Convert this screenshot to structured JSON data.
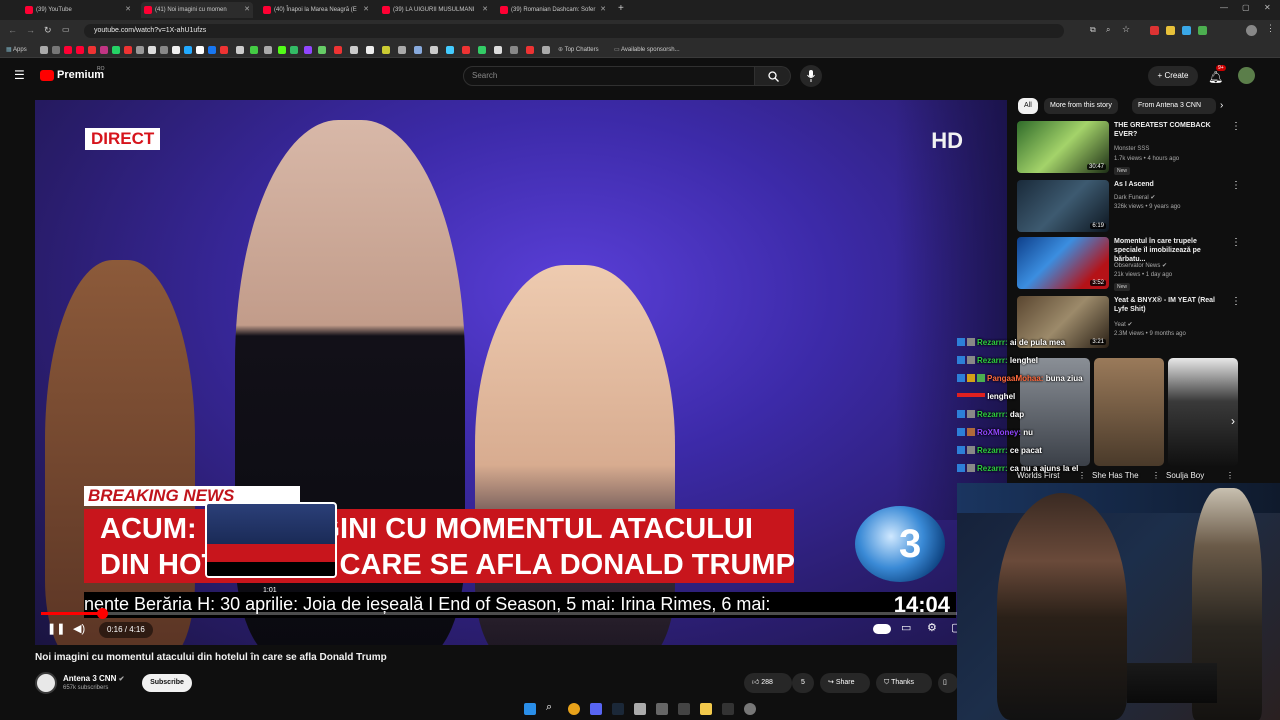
{
  "browser": {
    "tabs": [
      {
        "label": "(39) YouTube"
      },
      {
        "label": "(41) Noi imagini cu momen"
      },
      {
        "label": "(40) Înapoi la Marea Neagră (E"
      },
      {
        "label": "(39) LA UIGURII MUSULMANI"
      },
      {
        "label": "(39) Romanian Dashcam: Sofer"
      }
    ],
    "url": "youtube.com/watch?v=1X-ahU1ufzs",
    "bookmarks": {
      "apps": "Apps",
      "top_chatters": "Top Chatters",
      "sponsors": "Available sponsorsh..."
    }
  },
  "masthead": {
    "logo": "Premium",
    "logo_badge": "RO",
    "search_placeholder": "Search",
    "create_label": "Create",
    "notification_count": "9+"
  },
  "video": {
    "direct_label": "DIRECT",
    "hd_label": "HD",
    "breaking_label": "BREAKING NEWS",
    "headline_line1": "ACUM: NOI IMAGINI CU MOMENTUL ATACULUI",
    "headline_line2": "DIN HOTELUL ÎN CARE SE AFLA DONALD TRUMP",
    "ticker_text": "nente Berăria H: 30 aprilie: Joia de ieșeală I End of Season, 5 mai: Irina Rimes, 6 mai:",
    "ticker_time": "14:04",
    "preview_time": "1:01",
    "time_display": "0:16 / 4:16",
    "progress": 0.064
  },
  "info": {
    "title": "Noi imagini cu momentul atacului din hotelul în care se afla Donald Trump",
    "channel": "Antena 3 CNN",
    "subscribers": "657k subscribers",
    "subscribe_label": "Subscribe",
    "likes": "288",
    "comments": "5",
    "share_label": "Share",
    "thanks_label": "Thanks"
  },
  "sidebar": {
    "chips": [
      "All",
      "More from this story",
      "From Antena 3 CNN"
    ],
    "recommendations": [
      {
        "title": "THE GREATEST COMEBACK EVER?",
        "channel": "Monster SSS",
        "meta": "1.7k views • 4 hours ago",
        "duration": "30:47",
        "badge": "New"
      },
      {
        "title": "As I Ascend",
        "channel": "Dark Funeral",
        "meta": "326k views • 9 years ago",
        "duration": "6:19",
        "badge": ""
      },
      {
        "title": "Momentul în care trupele speciale îl imobilizează pe bărbatu...",
        "channel": "Observator News",
        "meta": "21k views • 1 day ago",
        "duration": "3:52",
        "badge": "New"
      },
      {
        "title": "Yeat & BNYX® - IM YEAT (Real Lyfe Shit)",
        "channel": "Yeat",
        "meta": "2.3M views • 9 months ago",
        "duration": "3:21",
        "badge": ""
      }
    ],
    "shorts": [
      {
        "title": "Worlds First"
      },
      {
        "title": "She Has The"
      },
      {
        "title": "Soulja Boy"
      }
    ]
  },
  "chat": [
    {
      "user": "Rezarrr:",
      "message": "ai de pula mea"
    },
    {
      "user": "Rezarrr:",
      "message": "lenghel"
    },
    {
      "user": "PangaaMohaa:",
      "message": "buna ziua"
    },
    {
      "user": "",
      "message": "lenghel"
    },
    {
      "user": "Rezarrr:",
      "message": "dap"
    },
    {
      "user": "RoXMoney:",
      "message": "nu"
    },
    {
      "user": "Rezarrr:",
      "message": "ce pacat"
    },
    {
      "user": "Rezarrr:",
      "message": "ca nu a ajuns la el"
    }
  ],
  "colors": {
    "accent": "#ff0000",
    "headline": "#c8151c",
    "chat_user": "#2ecc40"
  }
}
